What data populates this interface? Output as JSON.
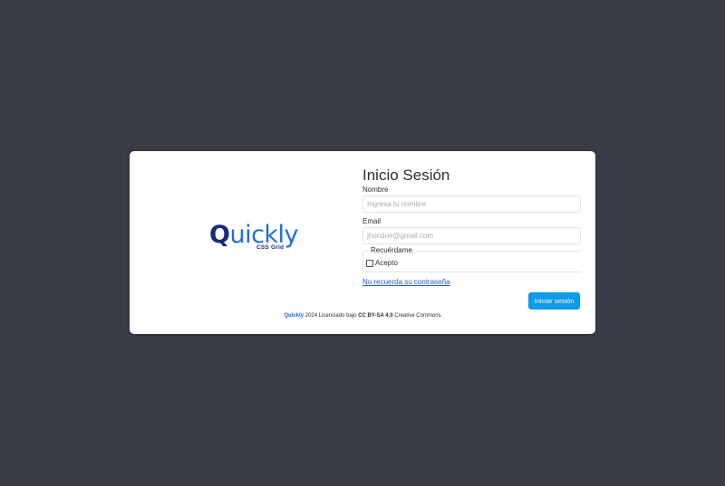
{
  "logo": {
    "word_first": "Q",
    "word_rest": "uickly",
    "subtitle": "CSS Grid"
  },
  "form": {
    "title": "Inicio Sesión",
    "name_label": "Nombre",
    "name_placeholder": "Ingresa tu nombre",
    "name_value": "",
    "email_label": "Email",
    "email_placeholder": "jhondoe@gmail.com",
    "email_value": "",
    "remember_legend": "Recuérdame.",
    "accept_label": "Acepto",
    "accept_checked": false,
    "forgot_link": "No recuerda su contraseña",
    "submit_label": "Iniciar sesión"
  },
  "footer": {
    "brand": "Quickly",
    "year_text": " 2024 Licenciado bajo ",
    "license": "CC BY-SA 4.0",
    "suffix": " Creative Commons"
  },
  "colors": {
    "background": "#383c46",
    "card": "#ffffff",
    "button": "#0d9be8",
    "link": "#1d5fd0",
    "logo_dark": "#1a2a7a",
    "logo_light": "#1e6fd9"
  }
}
